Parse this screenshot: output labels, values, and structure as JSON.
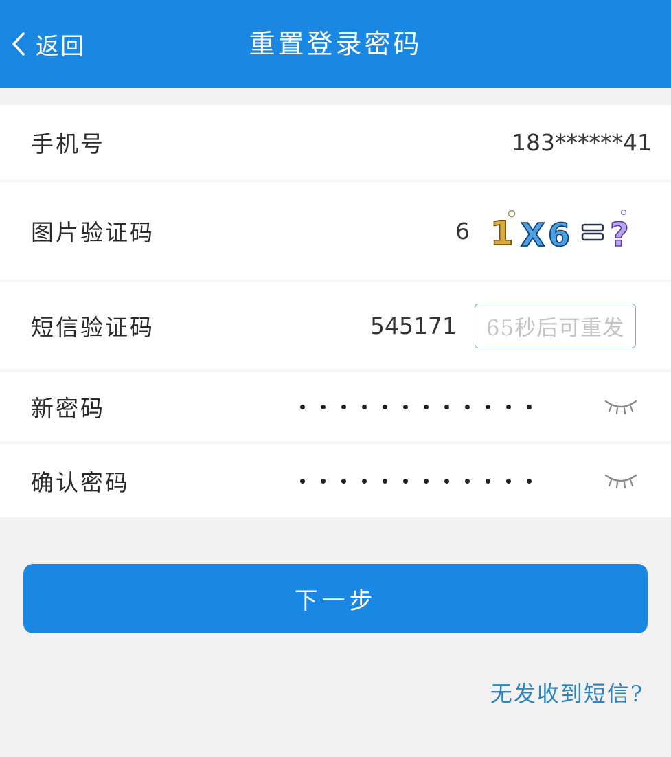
{
  "header": {
    "back_label": "返回",
    "title": "重置登录密码"
  },
  "form": {
    "phone": {
      "label": "手机号",
      "value": "183******41"
    },
    "captcha": {
      "label": "图片验证码",
      "value": "6",
      "image_text": "1X6=?"
    },
    "sms": {
      "label": "短信验证码",
      "value": "545171",
      "resend_label": "65秒后可重发"
    },
    "new_password": {
      "label": "新密码",
      "masked_length": 12
    },
    "confirm_password": {
      "label": "确认密码",
      "masked_length": 12
    }
  },
  "actions": {
    "next_label": "下一步",
    "no_sms_link": "无发收到短信?"
  },
  "icons": {
    "back": "chevron-left-icon",
    "eye": "eye-closed-icon"
  },
  "colors": {
    "primary": "#1a88e2",
    "link": "#2f84bf",
    "placeholder": "#c4c4c4"
  }
}
